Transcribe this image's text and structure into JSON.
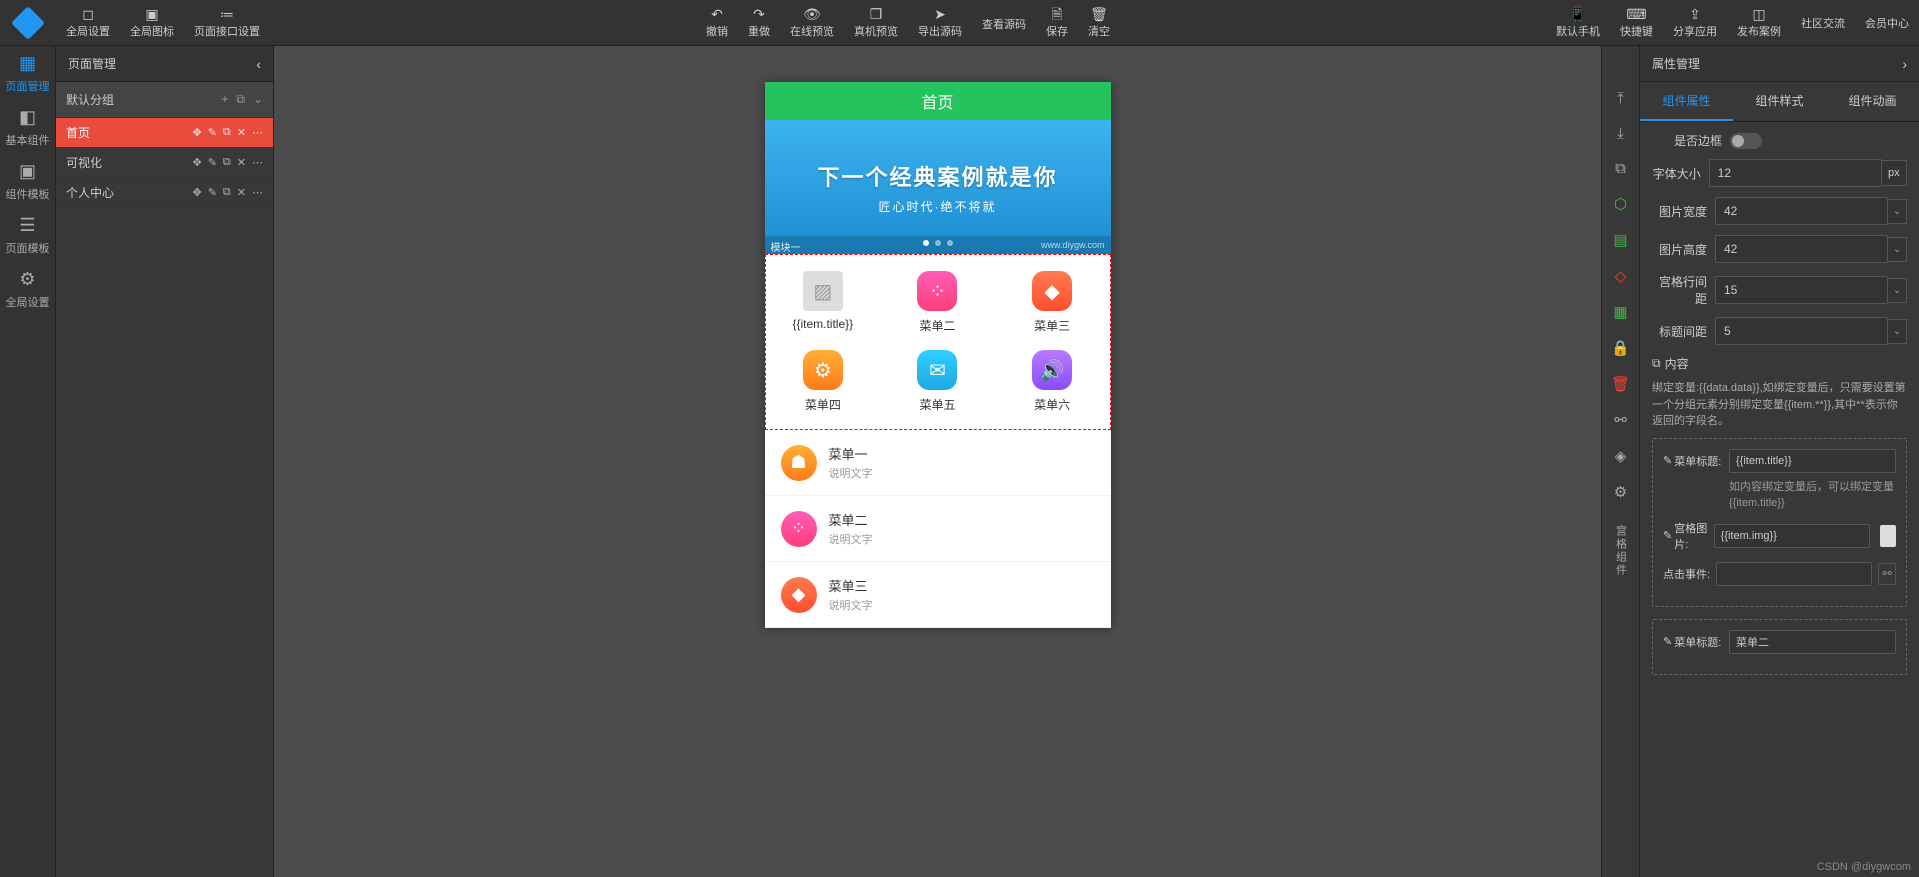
{
  "toolbar": {
    "left_items": [
      {
        "icon": "◻",
        "label": "全局设置"
      },
      {
        "icon": "▣",
        "label": "全局图标"
      },
      {
        "icon": "≔",
        "label": "页面接口设置"
      }
    ],
    "center_items": [
      {
        "icon": "↶",
        "label": "撤销"
      },
      {
        "icon": "↷",
        "label": "重做"
      },
      {
        "icon": "👁",
        "label": "在线预览"
      },
      {
        "icon": "❐",
        "label": "真机预览"
      },
      {
        "icon": "➤",
        "label": "导出源码"
      },
      {
        "icon": "</>",
        "label": "查看源码"
      },
      {
        "icon": "🗎",
        "label": "保存"
      },
      {
        "icon": "🗑",
        "label": "清空"
      }
    ],
    "right_items": [
      {
        "icon": "📱",
        "label": "默认手机"
      },
      {
        "icon": "⌨",
        "label": "快捷键"
      },
      {
        "icon": "⇪",
        "label": "分享应用"
      },
      {
        "icon": "◫",
        "label": "发布案例"
      },
      {
        "icon": "",
        "label": "社区交流"
      },
      {
        "icon": "",
        "label": "会员中心"
      }
    ]
  },
  "left_rail": [
    {
      "icon": "▦",
      "label": "页面管理",
      "active": true
    },
    {
      "icon": "◧",
      "label": "基本组件"
    },
    {
      "icon": "▣",
      "label": "组件模板"
    },
    {
      "icon": "☰",
      "label": "页面模板"
    },
    {
      "icon": "⚙",
      "label": "全局设置"
    }
  ],
  "left_panel": {
    "title": "页面管理",
    "group_name": "默认分组",
    "pages": [
      {
        "name": "首页",
        "active": true
      },
      {
        "name": "可视化",
        "active": false
      },
      {
        "name": "个人中心",
        "active": false
      }
    ]
  },
  "canvas": {
    "header": "首页",
    "banner": {
      "line1": "下一个经典案例就是你",
      "line2": "匠心时代·绝不将就",
      "strip": "模块一",
      "corner": "www.diygw.com"
    },
    "grid": [
      {
        "label": "{{item.title}}",
        "cls": "g-placeholder",
        "glyph": "▨"
      },
      {
        "label": "菜单二",
        "cls": "g-pink",
        "glyph": "⁘"
      },
      {
        "label": "菜单三",
        "cls": "g-red",
        "glyph": "◆"
      },
      {
        "label": "菜单四",
        "cls": "g-orange",
        "glyph": "⚙"
      },
      {
        "label": "菜单五",
        "cls": "g-blue",
        "glyph": "✉"
      },
      {
        "label": "菜单六",
        "cls": "g-purple",
        "glyph": "🔊"
      }
    ],
    "list": [
      {
        "title": "菜单一",
        "sub": "说明文字",
        "cls": "g-orange",
        "glyph": "☗"
      },
      {
        "title": "菜单二",
        "sub": "说明文字",
        "cls": "g-pink",
        "glyph": "⁘"
      },
      {
        "title": "菜单三",
        "sub": "说明文字",
        "cls": "g-red",
        "glyph": "◆"
      }
    ]
  },
  "right_rail_label": "宫格组件",
  "right_panel": {
    "title": "属性管理",
    "tabs": [
      "组件属性",
      "组件样式",
      "组件动画"
    ],
    "active_tab": 0,
    "props": {
      "border_label": "是否边框",
      "font_size_label": "字体大小",
      "font_size_value": "12",
      "font_size_unit": "px",
      "img_width_label": "图片宽度",
      "img_width_value": "42",
      "img_height_label": "图片高度",
      "img_height_value": "42",
      "row_gap_label": "宫格行间距",
      "row_gap_value": "15",
      "title_gap_label": "标题间距",
      "title_gap_value": "5"
    },
    "content": {
      "header": "内容",
      "desc": "绑定变量:{{data.data}},如绑定变量后，只需要设置第一个分组元素分别绑定变量{{item.**}},其中**表示你返回的字段名。",
      "box1": {
        "f1_label": "菜单标题:",
        "f1_value": "{{item.title}}",
        "f1_hint": "如内容绑定变量后，可以绑定变量{{item.title}}",
        "f2_label": "宫格图片:",
        "f2_value": "{{item.img}}",
        "f3_label": "点击事件:",
        "f3_value": ""
      },
      "box2": {
        "f1_label": "菜单标题:",
        "f1_value": "菜单二"
      }
    }
  },
  "watermark": "CSDN @diygwcom"
}
